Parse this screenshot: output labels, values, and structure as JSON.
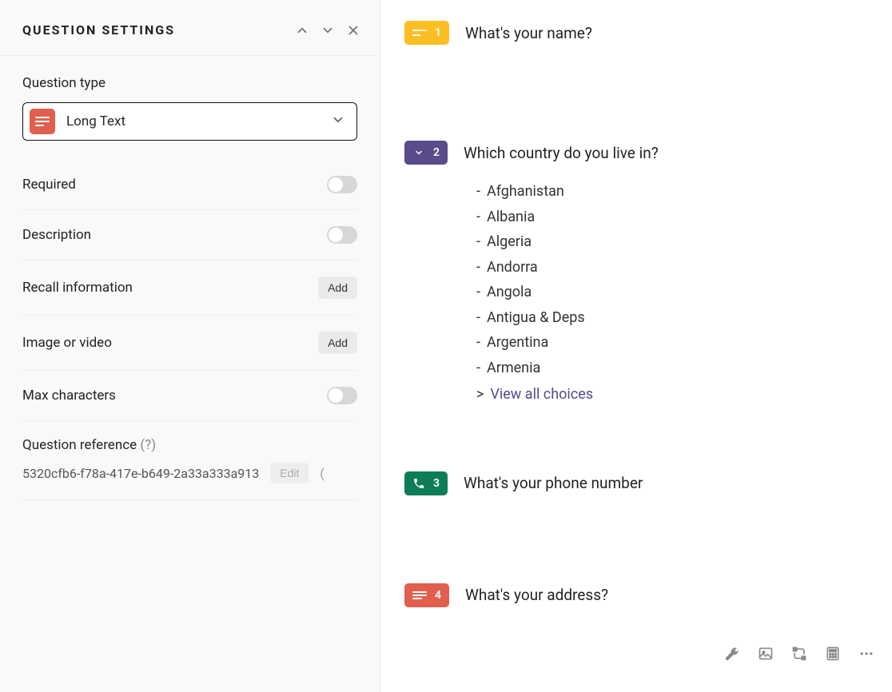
{
  "settings": {
    "title": "QUESTION SETTINGS",
    "type_label": "Question type",
    "type_value": "Long Text",
    "type_icon_name": "long-text-icon",
    "type_color": "#e15f4d",
    "rows": {
      "required": "Required",
      "description": "Description",
      "recall": "Recall information",
      "image_video": "Image or video",
      "max_chars": "Max characters"
    },
    "add_btn": "Add",
    "reference_label": "Question reference",
    "reference_help": "(?)",
    "reference_value": "5320cfb6-f78a-417e-b649-2a33a333a913",
    "edit_btn": "Edit",
    "trunc": "("
  },
  "questions": {
    "q1": {
      "number": "1",
      "title": "What's your name?",
      "color": "#fbbf24",
      "icon": "short-text-icon"
    },
    "q2": {
      "number": "2",
      "title": "Which country do you live in?",
      "color": "#5a4b8a",
      "icon": "dropdown-icon",
      "choices": [
        "Afghanistan",
        "Albania",
        "Algeria",
        "Andorra",
        "Angola",
        "Antigua & Deps",
        "Argentina",
        "Armenia"
      ],
      "view_all": "View all choices"
    },
    "q3": {
      "number": "3",
      "title": "What's your phone number",
      "color": "#0d7d56",
      "icon": "phone-icon"
    },
    "q4": {
      "number": "4",
      "title": "What's your address?",
      "color": "#e15f4d",
      "icon": "long-text-icon"
    }
  },
  "toolbar_icons": [
    "wrench-icon",
    "image-icon",
    "logic-icon",
    "calculator-icon",
    "more-icon"
  ]
}
